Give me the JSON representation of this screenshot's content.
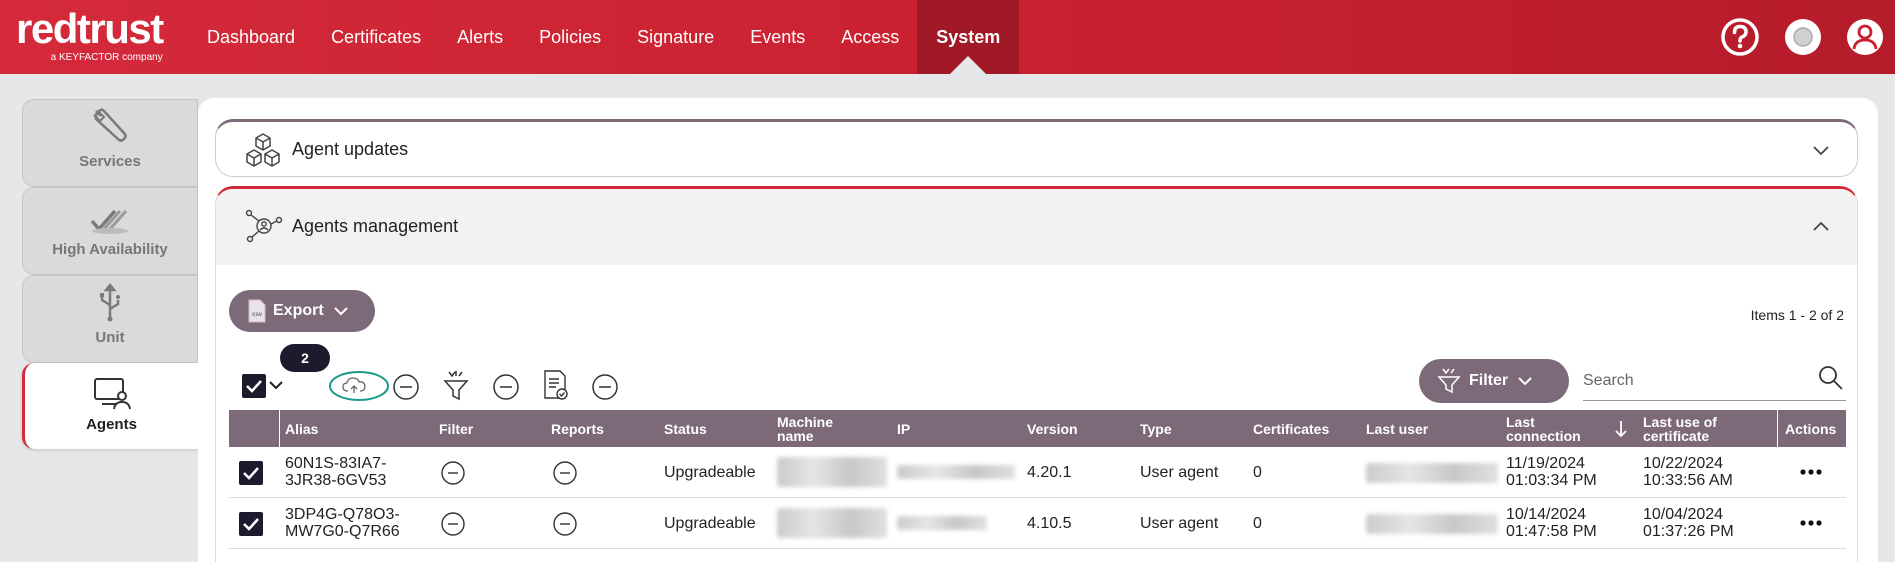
{
  "brand": {
    "name": "redtrust",
    "tagline": "a KEYFACTOR company"
  },
  "nav": {
    "items": [
      {
        "label": "Dashboard"
      },
      {
        "label": "Certificates"
      },
      {
        "label": "Alerts"
      },
      {
        "label": "Policies"
      },
      {
        "label": "Signature"
      },
      {
        "label": "Events"
      },
      {
        "label": "Access"
      },
      {
        "label": "System",
        "active": true
      }
    ]
  },
  "header_icons": [
    "help-icon",
    "status-icon",
    "user-icon"
  ],
  "sidebar": {
    "items": [
      {
        "label": "Services",
        "icon": "wrench-icon"
      },
      {
        "label": "High Availability",
        "icon": "double-check-icon"
      },
      {
        "label": "Unit",
        "icon": "usb-icon"
      },
      {
        "label": "Agents",
        "icon": "agent-computer-icon",
        "active": true
      }
    ]
  },
  "sections": {
    "updates": {
      "title": "Agent updates",
      "icon": "boxes-icon"
    },
    "management": {
      "title": "Agents management",
      "icon": "agents-network-icon"
    }
  },
  "toolbar": {
    "export_label": "Export",
    "items_count": "Items 1 - 2 of 2",
    "selected_count": "2",
    "filter_label": "Filter",
    "search_placeholder": "Search"
  },
  "table": {
    "headers": {
      "alias": "Alias",
      "filter": "Filter",
      "reports": "Reports",
      "status": "Status",
      "machine_name": "Machine name",
      "ip": "IP",
      "version": "Version",
      "type": "Type",
      "certificates": "Certificates",
      "last_user": "Last user",
      "last_connection": "Last connection",
      "last_use": "Last use of certificate",
      "actions": "Actions"
    },
    "rows": [
      {
        "alias_1": "60N1S-83IA7-",
        "alias_2": "3JR38-6GV53",
        "status": "Upgradeable",
        "version": "4.20.1",
        "type": "User agent",
        "certificates": "0",
        "last_connection_1": "11/19/2024",
        "last_connection_2": "01:03:34 PM",
        "last_use_1": "10/22/2024",
        "last_use_2": "10:33:56 AM"
      },
      {
        "alias_1": "3DP4G-Q78O3-",
        "alias_2": "MW7G0-Q7R66",
        "status": "Upgradeable",
        "version": "4.10.5",
        "type": "User agent",
        "certificates": "0",
        "last_connection_1": "10/14/2024",
        "last_connection_2": "01:47:58 PM",
        "last_use_1": "10/04/2024",
        "last_use_2": "01:37:26 PM"
      }
    ]
  },
  "colors": {
    "brand_red": "#d42a3b",
    "active_nav": "#a11826",
    "accent_purple": "#7d6a79",
    "dark": "#1e1a2e",
    "teal": "#1a9a8a"
  }
}
